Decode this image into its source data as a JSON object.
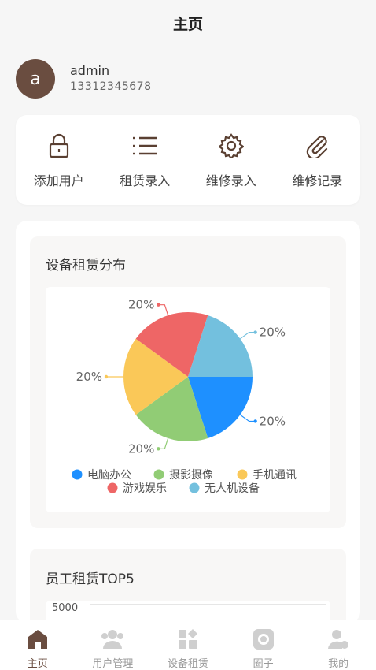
{
  "header": {
    "title": "主页"
  },
  "profile": {
    "avatar_letter": "a",
    "name": "admin",
    "phone": "13312345678"
  },
  "quick_actions": [
    {
      "label": "添加用户",
      "icon": "lock-icon"
    },
    {
      "label": "租赁录入",
      "icon": "list-icon"
    },
    {
      "label": "维修录入",
      "icon": "gear-icon"
    },
    {
      "label": "维修记录",
      "icon": "paperclip-icon"
    }
  ],
  "colors": {
    "accent": "#6a4d40",
    "icon": "#5a4032"
  },
  "chart_section": {
    "title": "设备租赁分布"
  },
  "chart_data": {
    "type": "pie",
    "title": "设备租赁分布",
    "categories": [
      "电脑办公",
      "摄影摄像",
      "手机通讯",
      "游戏娱乐",
      "无人机设备"
    ],
    "values": [
      20,
      20,
      20,
      20,
      20
    ],
    "labels": [
      "20%",
      "20%",
      "20%",
      "20%",
      "20%"
    ],
    "colors": [
      "#1e90ff",
      "#91cc75",
      "#fac858",
      "#ee6666",
      "#73c0de"
    ],
    "legend": "bottom"
  },
  "top5_section": {
    "title": "员工租赁TOP5",
    "tick": "5000"
  },
  "tabs": [
    {
      "label": "主页",
      "icon": "home-icon",
      "active": true
    },
    {
      "label": "用户管理",
      "icon": "users-icon",
      "active": false
    },
    {
      "label": "设备租赁",
      "icon": "grid-icon",
      "active": false
    },
    {
      "label": "圈子",
      "icon": "circle-icon",
      "active": false
    },
    {
      "label": "我的",
      "icon": "profile-icon",
      "active": false
    }
  ]
}
